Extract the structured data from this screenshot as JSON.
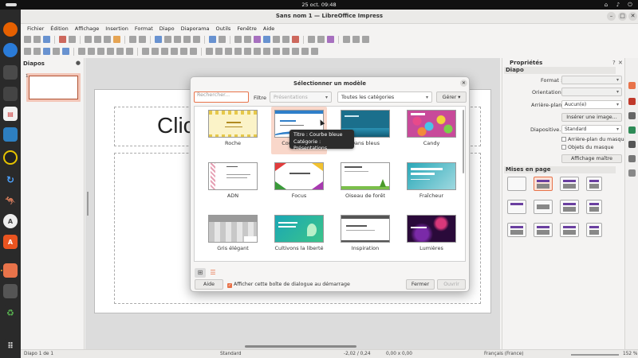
{
  "system": {
    "clock": "25 oct.  09:48"
  },
  "window": {
    "title": "Sans nom 1 — LibreOffice Impress"
  },
  "menu": [
    "Fichier",
    "Édition",
    "Affichage",
    "Insertion",
    "Format",
    "Diapo",
    "Diaporama",
    "Outils",
    "Fenêtre",
    "Aide"
  ],
  "slides_pane": {
    "title": "Diapos",
    "slide_number": "1"
  },
  "edit_area": {
    "title_placeholder": "Clic"
  },
  "sidebar": {
    "title": "Propriétés",
    "section_slide": "Diapo",
    "format_label": "Format :",
    "orientation_label": "Orientation :",
    "background_label": "Arrière-plan :",
    "background_value": "Aucun(e)",
    "insert_image_button": "Insérer une image...",
    "master_label": "Diapositive...",
    "master_value": "Standard",
    "master_bg_check": "Arrière-plan du masque",
    "master_objects_check": "Objets du masque",
    "master_view_button": "Affichage maître",
    "section_layouts": "Mises en page"
  },
  "status": {
    "slide_info": "Diapo 1 de 1",
    "master": "Standard",
    "position": "-2,02 / 0,24",
    "size": "0,00 x 0,00",
    "language": "Français (France)",
    "zoom": "152 %"
  },
  "dialog": {
    "title": "Sélectionner un modèle",
    "search_placeholder": "Rechercher...",
    "filter_label": "Filtre",
    "filter_value": "Présentations",
    "category_value": "Toutes les catégories",
    "manage_label": "Gérer",
    "templates": [
      {
        "name": "Roche"
      },
      {
        "name": "Courbe bleue"
      },
      {
        "name": "Dans bleus"
      },
      {
        "name": "Candy"
      },
      {
        "name": "ADN"
      },
      {
        "name": "Focus"
      },
      {
        "name": "Oiseau de forêt"
      },
      {
        "name": "Fraîcheur"
      },
      {
        "name": "Gris élégant"
      },
      {
        "name": "Cultivons la liberté"
      },
      {
        "name": "Inspiration"
      },
      {
        "name": "Lumières"
      }
    ],
    "tooltip_line1": "Titre : Courbe bleue",
    "tooltip_line2": "Catégorie : Présentations",
    "help_button": "Aide",
    "startup_check": "Afficher cette boîte de dialogue au démarrage",
    "close_button": "Fermer",
    "open_button": "Ouvrir"
  },
  "colors": {
    "accent": "#e8734a",
    "selection": "#f9d7ca"
  }
}
